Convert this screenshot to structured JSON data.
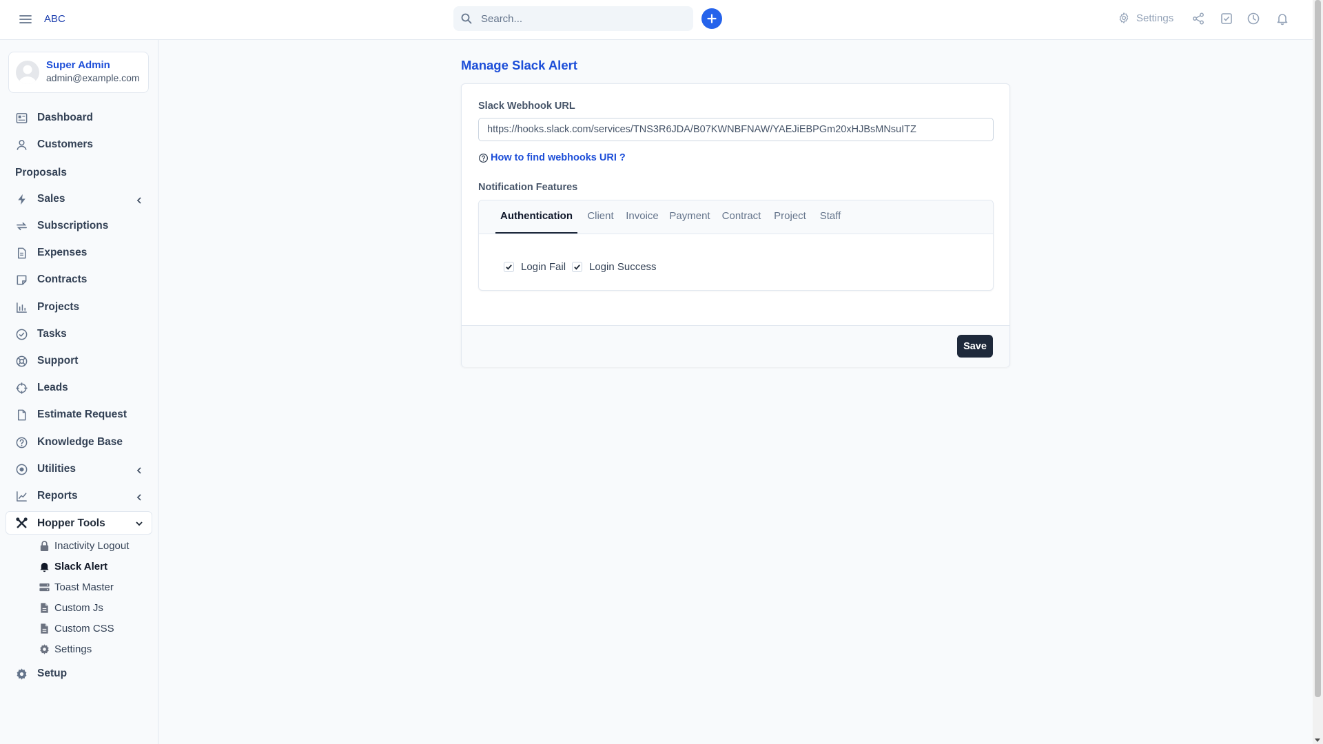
{
  "topbar": {
    "brand": "ABC",
    "search_placeholder": "Search...",
    "settings_label": "Settings",
    "icons": [
      "menu-icon",
      "search-icon",
      "plus-icon",
      "gear-icon",
      "share-icon",
      "check-square-icon",
      "clock-icon",
      "bell-icon"
    ]
  },
  "profile": {
    "name": "Super Admin",
    "email": "admin@example.com"
  },
  "sidebar": {
    "items": [
      {
        "label": "Dashboard",
        "icon": "dashboard-icon"
      },
      {
        "label": "Customers",
        "icon": "user-icon"
      },
      {
        "label": "Proposals",
        "icon": ""
      },
      {
        "label": "Sales",
        "icon": "bolt-icon"
      },
      {
        "label": "Subscriptions",
        "icon": "repeat-icon"
      },
      {
        "label": "Expenses",
        "icon": "document-icon"
      },
      {
        "label": "Contracts",
        "icon": "note-icon"
      },
      {
        "label": "Projects",
        "icon": "chart-icon"
      },
      {
        "label": "Tasks",
        "icon": "check-circle-icon"
      },
      {
        "label": "Support",
        "icon": "lifebuoy-icon"
      },
      {
        "label": "Leads",
        "icon": "crosshair-icon"
      },
      {
        "label": "Estimate Request",
        "icon": "file-icon"
      },
      {
        "label": "Knowledge Base",
        "icon": "question-circle-icon"
      },
      {
        "label": "Utilities",
        "icon": "dot-circle-icon"
      },
      {
        "label": "Reports",
        "icon": "line-chart-icon"
      },
      {
        "label": "Hopper Tools",
        "icon": "tools-icon"
      },
      {
        "label": "Setup",
        "icon": "gear-icon"
      }
    ],
    "hopper_sub": [
      {
        "label": "Inactivity Logout",
        "icon": "lock-icon"
      },
      {
        "label": "Slack Alert",
        "icon": "bell-icon",
        "active": true
      },
      {
        "label": "Toast Master",
        "icon": "server-icon"
      },
      {
        "label": "Custom Js",
        "icon": "file-code-icon"
      },
      {
        "label": "Custom CSS",
        "icon": "file-code-icon"
      },
      {
        "label": "Settings",
        "icon": "gear-icon"
      }
    ]
  },
  "main": {
    "title": "Manage Slack Alert",
    "webhook_label": "Slack Webhook URL",
    "webhook_value": "https://hooks.slack.com/services/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",
    "help_link": "How to find webhooks URI ?",
    "features_label": "Notification Features",
    "tabs": [
      "Authentication",
      "Client",
      "Invoice",
      "Payment",
      "Contract",
      "Project",
      "Staff"
    ],
    "active_tab": "Authentication",
    "checkboxes": [
      {
        "label": "Login Fail",
        "checked": true
      },
      {
        "label": "Login Success",
        "checked": true
      }
    ],
    "save_label": "Save"
  },
  "colors": {
    "accent": "#1d4ed8",
    "plus_button": "#2563eb",
    "save_button": "#1e293b"
  }
}
